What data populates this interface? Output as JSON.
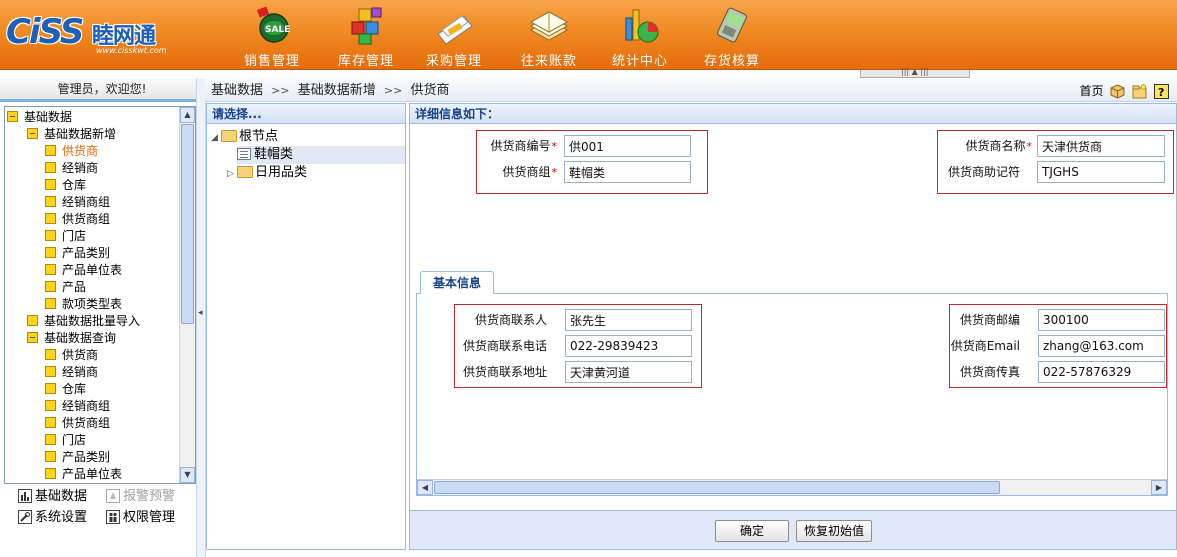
{
  "header": {
    "logo_text": "CiSS",
    "logo_cn": "睦网通",
    "logo_url": "www.cisskwt.com",
    "nav": [
      {
        "label": "销售管理",
        "icon": "sale-icon"
      },
      {
        "label": "库存管理",
        "icon": "inventory-icon"
      },
      {
        "label": "采购管理",
        "icon": "purchase-icon"
      },
      {
        "label": "往来账款",
        "icon": "accounts-icon"
      },
      {
        "label": "统计中心",
        "icon": "statistics-icon"
      },
      {
        "label": "存货核算",
        "icon": "stock-accounting-icon"
      }
    ]
  },
  "sidebar": {
    "welcome": "管理员，欢迎您!",
    "tree": [
      {
        "label": "基础数据",
        "kind": "minus"
      },
      {
        "label": "基础数据新增",
        "kind": "minus"
      },
      {
        "label": "供货商",
        "kind": "item",
        "selected": true
      },
      {
        "label": "经销商",
        "kind": "item"
      },
      {
        "label": "仓库",
        "kind": "item"
      },
      {
        "label": "经销商组",
        "kind": "item"
      },
      {
        "label": "供货商组",
        "kind": "item"
      },
      {
        "label": "门店",
        "kind": "item"
      },
      {
        "label": "产品类别",
        "kind": "item"
      },
      {
        "label": "产品单位表",
        "kind": "item"
      },
      {
        "label": "产品",
        "kind": "item"
      },
      {
        "label": "款项类型表",
        "kind": "item"
      },
      {
        "label": "基础数据批量导入",
        "kind": "plus"
      },
      {
        "label": "基础数据查询",
        "kind": "minus"
      },
      {
        "label": "供货商",
        "kind": "item"
      },
      {
        "label": "经销商",
        "kind": "item"
      },
      {
        "label": "仓库",
        "kind": "item"
      },
      {
        "label": "经销商组",
        "kind": "item"
      },
      {
        "label": "供货商组",
        "kind": "item"
      },
      {
        "label": "门店",
        "kind": "item"
      },
      {
        "label": "产品类别",
        "kind": "item"
      },
      {
        "label": "产品单位表",
        "kind": "item"
      }
    ],
    "links": {
      "basic_data": "基础数据",
      "alarm": "报警预警",
      "settings": "系统设置",
      "permission": "权限管理"
    }
  },
  "breadcrumb": {
    "items": [
      "基础数据",
      "基础数据新增",
      "供货商"
    ],
    "separator": ">>",
    "home": "首页"
  },
  "category_panel": {
    "title": "请选择...",
    "root": "根节点",
    "children": [
      {
        "label": "鞋帽类",
        "selected": true
      },
      {
        "label": "日用品类"
      }
    ]
  },
  "detail": {
    "title": "详细信息如下：",
    "top_left": [
      {
        "label": "供货商编号",
        "required": "*",
        "value": "供001"
      },
      {
        "label": "供货商组",
        "required": "*",
        "value": "鞋帽类"
      }
    ],
    "top_right": [
      {
        "label": "供货商名称",
        "required": "*",
        "value": "天津供货商"
      },
      {
        "label": "供货商助记符",
        "required": "",
        "value": "TJGHS"
      }
    ],
    "tab_label": "基本信息",
    "tab_left": [
      {
        "label": "供货商联系人",
        "value": "张先生"
      },
      {
        "label": "供货商联系电话",
        "value": "022-29839423"
      },
      {
        "label": "供货商联系地址",
        "value": "天津黄河道"
      }
    ],
    "tab_right": [
      {
        "label": "供货商邮编",
        "value": "300100"
      },
      {
        "label": "供货商Email",
        "value": "zhang@163.com"
      },
      {
        "label": "供货商传真",
        "value": "022-57876329"
      }
    ],
    "confirm_button": "确定",
    "reset_button": "恢复初始值"
  },
  "colors": {
    "header_orange": "#f08a22",
    "panel_border": "#99bbe8",
    "panel_title": "#15428b",
    "form_box_border": "#c0282d",
    "selected_tree_text": "#e06600"
  }
}
